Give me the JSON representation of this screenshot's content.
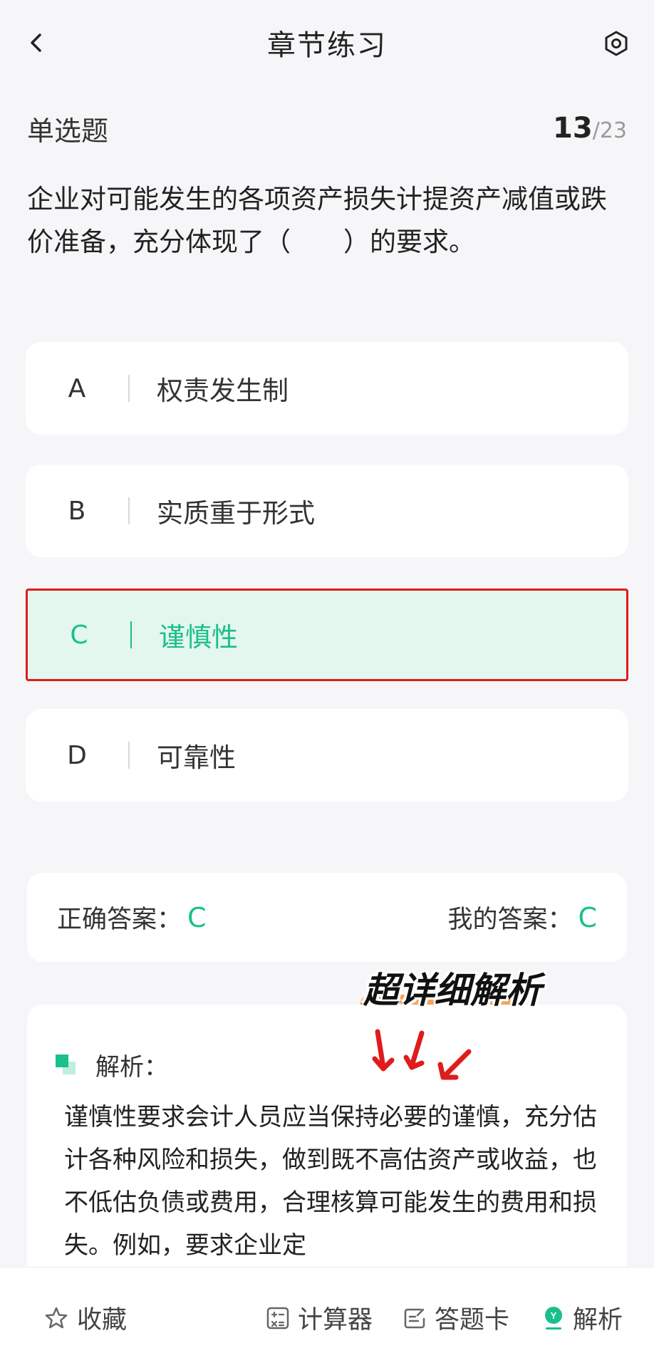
{
  "header": {
    "title": "章节练习",
    "back_icon": "chevron-left-icon",
    "settings_icon": "settings-hex-icon"
  },
  "question": {
    "type": "单选题",
    "progress_current": "13",
    "progress_sep": "/",
    "progress_total": "23",
    "text": "企业对可能发生的各项资产损失计提资产减值或跌价准备，充分体现了（　　）的要求。"
  },
  "options": [
    {
      "letter": "A",
      "text": "权责发生制"
    },
    {
      "letter": "B",
      "text": "实质重于形式"
    },
    {
      "letter": "C",
      "text": "谨慎性"
    },
    {
      "letter": "D",
      "text": "可靠性"
    }
  ],
  "answers": {
    "correct_label": "正确答案：",
    "correct_value": "C",
    "mine_label": "我的答案：",
    "mine_value": "C"
  },
  "annotation": {
    "tag": "超详细解析"
  },
  "analysis": {
    "title": "解析：",
    "text": "谨慎性要求会计人员应当保持必要的谨慎，充分估计各种风险和损失，做到既不高估资产或收益，也不低估负债或费用，合理核算可能发生的费用和损失。例如，要求企业定"
  },
  "bottom_bar": {
    "favorite": "收藏",
    "calculator": "计算器",
    "answer_card": "答题卡",
    "analysis": "解析"
  },
  "colors": {
    "accent": "#1bbf8b",
    "highlight_border": "#e01b1b",
    "annotation_arrow": "#e01b1b",
    "annotation_bg": "#f7a25a"
  }
}
